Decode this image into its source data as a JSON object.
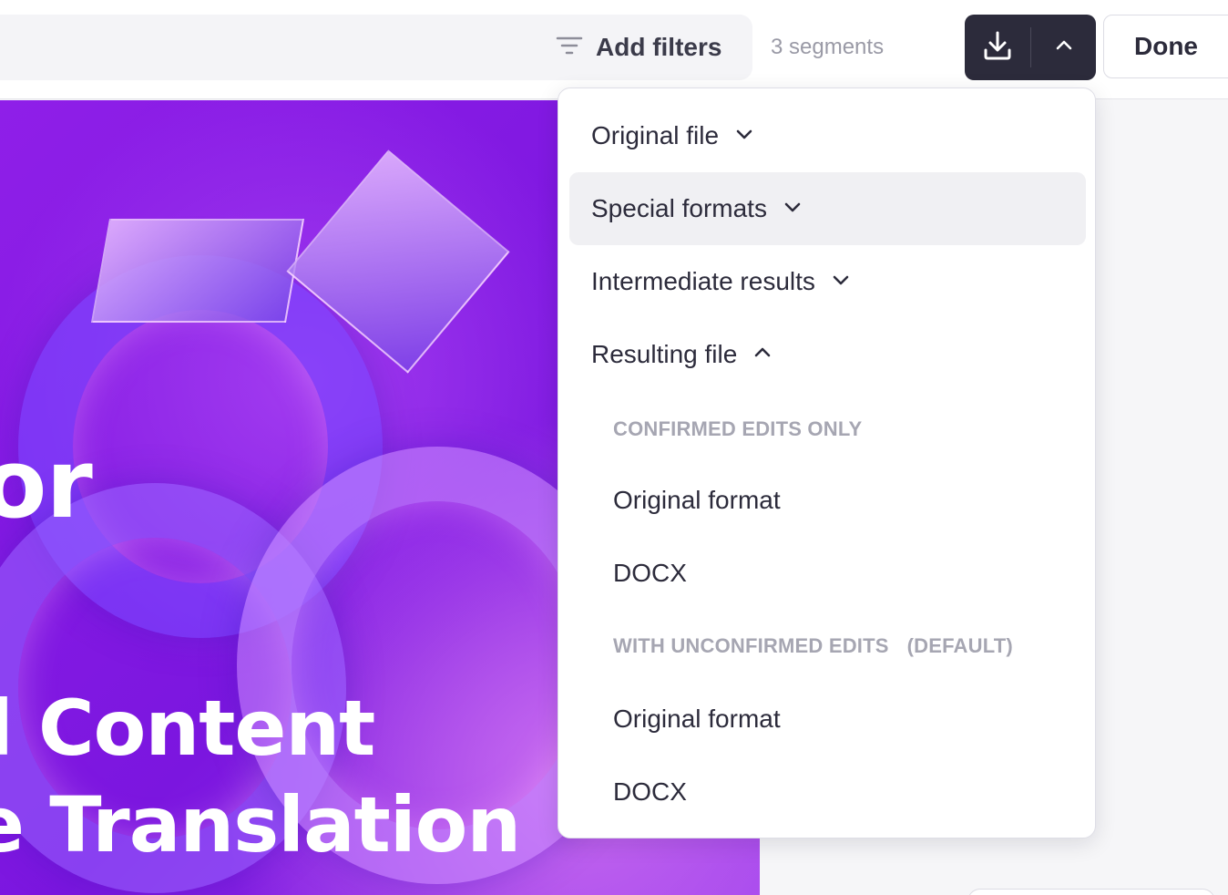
{
  "toolbar": {
    "add_filters_label": "Add filters",
    "filter_icon": "filter-icon",
    "segments_count": "3 segments",
    "download_icon": "download-icon",
    "caret_icon": "chevron-up-icon",
    "done_label": "Done"
  },
  "preview": {
    "line1": "or",
    "line2": "l Content",
    "line3": "e Translation"
  },
  "dropdown": {
    "items": [
      {
        "label": "Original file",
        "icon": "chevron-down-icon",
        "expanded": false
      },
      {
        "label": "Special formats",
        "icon": "chevron-down-icon",
        "expanded": false
      },
      {
        "label": "Intermediate results",
        "icon": "chevron-down-icon",
        "expanded": false
      },
      {
        "label": "Resulting file",
        "icon": "chevron-up-icon",
        "expanded": true
      }
    ],
    "resulting_file": {
      "confirmed_label": "CONFIRMED EDITS ONLY",
      "confirmed_options": [
        "Original format",
        "DOCX"
      ],
      "unconfirmed_label": "WITH UNCONFIRMED EDITS",
      "unconfirmed_default": "(DEFAULT)",
      "unconfirmed_options": [
        "Original format",
        "DOCX"
      ]
    }
  },
  "colors": {
    "primary_dark": "#2c2b3b",
    "muted_text": "#9a9aa6",
    "hover_bg": "#f0f0f3",
    "preview_purple": "#8f1fe8"
  }
}
